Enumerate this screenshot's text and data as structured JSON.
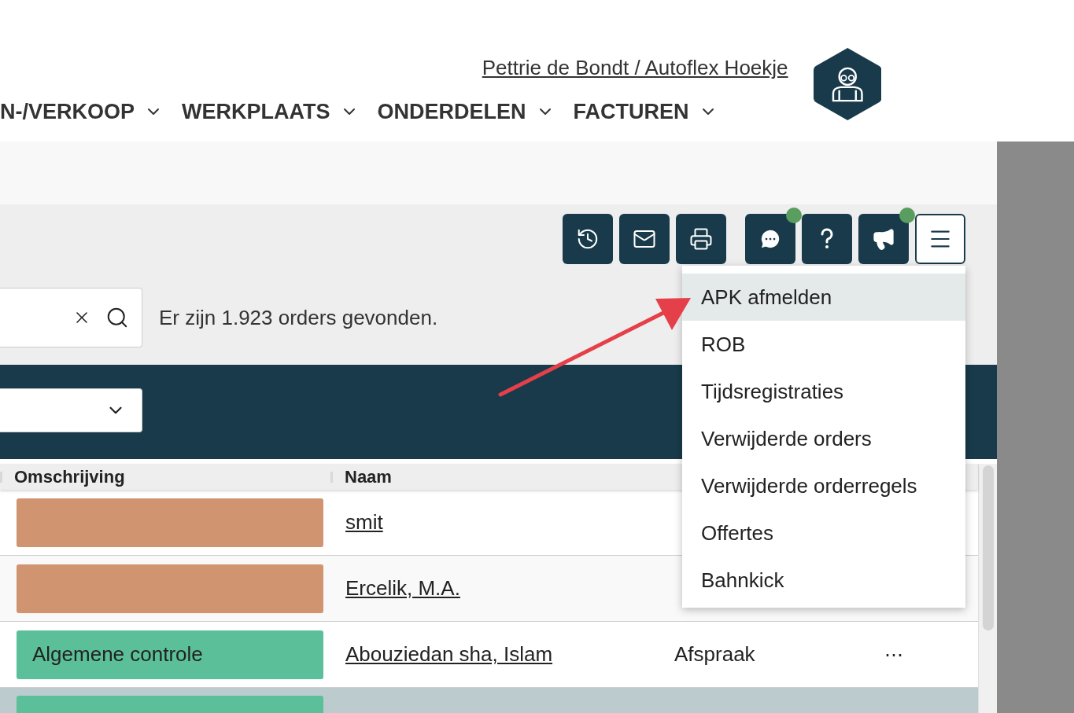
{
  "user": {
    "name": "Pettrie de Bondt / Autoflex Hoekje"
  },
  "nav": [
    {
      "label": "N-/VERKOOP"
    },
    {
      "label": "WERKPLAATS"
    },
    {
      "label": "ONDERDELEN"
    },
    {
      "label": "FACTUREN"
    }
  ],
  "toolbar": [
    {
      "kind": "history",
      "notification": false
    },
    {
      "kind": "mail",
      "notification": false
    },
    {
      "kind": "print",
      "notification": false
    },
    {
      "kind": "chat",
      "notification": true
    },
    {
      "kind": "help",
      "notification": false
    },
    {
      "kind": "announce",
      "notification": true
    },
    {
      "kind": "menu",
      "notification": false
    }
  ],
  "search": {
    "result": "Er zijn 1.923 orders gevonden."
  },
  "table": {
    "columns": [
      "Omschrijving",
      "Naam"
    ],
    "rows": [
      {
        "color": "#d09470",
        "name": "smit",
        "selected": false
      },
      {
        "color": "#d09470",
        "name": "Ercelik, M.A.",
        "selected": false
      },
      {
        "color": "#5bc09a",
        "description": "Algemene controle",
        "name": "Abouziedan sha, Islam",
        "column_3": "Afspraak",
        "more": "⋯",
        "selected": false
      },
      {
        "color": "#5bc09a",
        "selected": true
      }
    ]
  },
  "menu": [
    {
      "label": "APK afmelden",
      "selected": true
    },
    {
      "label": "ROB",
      "selected": false
    },
    {
      "label": "Tijdsregistraties",
      "selected": false
    },
    {
      "label": "Verwijderde orders",
      "selected": false
    },
    {
      "label": "Verwijderde orderregels",
      "selected": false
    },
    {
      "label": "Offertes",
      "selected": false
    },
    {
      "label": "Bahnkick",
      "selected": false
    }
  ]
}
